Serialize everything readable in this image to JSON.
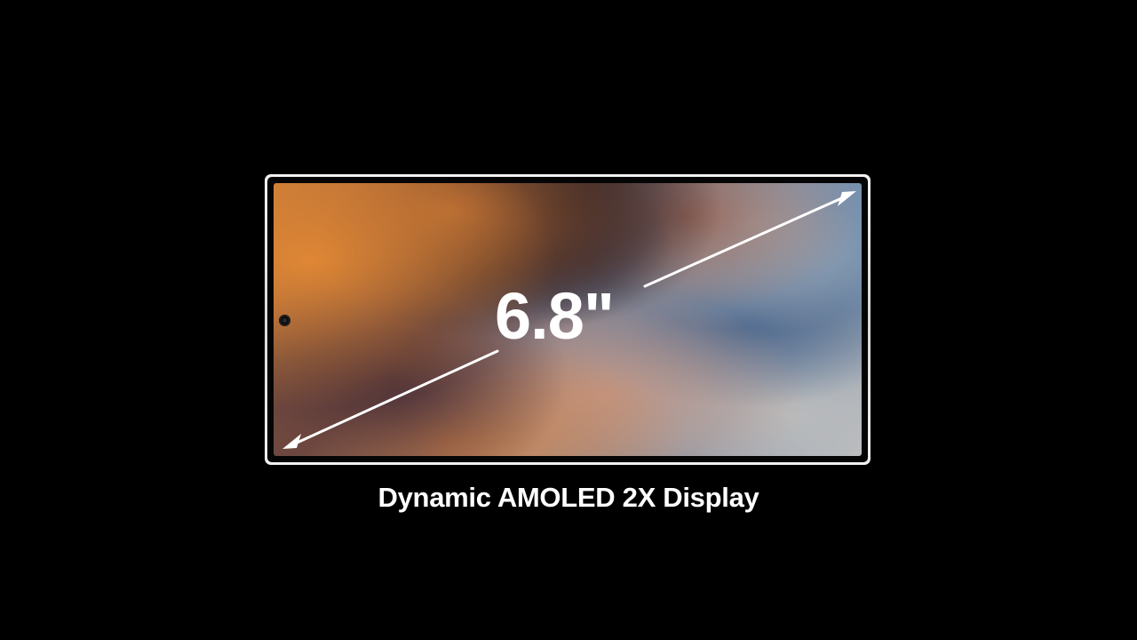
{
  "display": {
    "diagonal_size": "6.8\"",
    "caption": "Dynamic AMOLED 2X Display"
  },
  "colors": {
    "background": "#000000",
    "frame": "#e6e6e6",
    "text": "#ffffff",
    "arrow": "#ffffff"
  },
  "icons": {
    "camera": "camera-hole-icon",
    "diagonal_arrow": "double-arrow-icon"
  }
}
